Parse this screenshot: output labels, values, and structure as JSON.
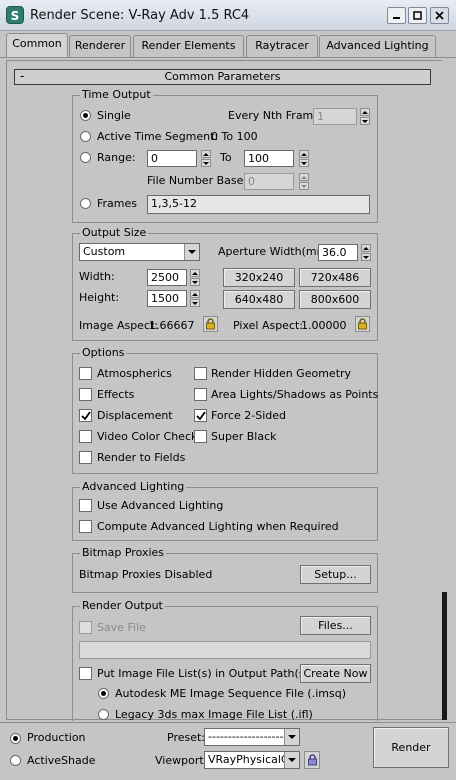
{
  "window": {
    "title": "Render Scene: V-Ray Adv 1.5 RC4",
    "app_icon_glyph": "S"
  },
  "tabs": [
    "Common",
    "Renderer",
    "Render Elements",
    "Raytracer",
    "Advanced Lighting"
  ],
  "active_tab": "Common",
  "rollout": {
    "title": "Common Parameters",
    "toggle": "-"
  },
  "time_output": {
    "title": "Time Output",
    "single_label": "Single",
    "single_selected": true,
    "every_nth_label": "Every Nth Frame:",
    "every_nth_value": "1",
    "active_segment_label": "Active Time Segment:",
    "active_segment_value": "0 To 100",
    "range_label": "Range:",
    "range_from": "0",
    "range_to_label": "To",
    "range_to": "100",
    "file_number_base_label": "File Number Base:",
    "file_number_base_value": "0",
    "frames_label": "Frames",
    "frames_value": "1,3,5-12"
  },
  "output_size": {
    "title": "Output Size",
    "preset_value": "Custom",
    "aperture_label": "Aperture Width(mm):",
    "aperture_value": "36.0",
    "width_label": "Width:",
    "width_value": "2500",
    "height_label": "Height:",
    "height_value": "1500",
    "presets": [
      "320x240",
      "720x486",
      "640x480",
      "800x600"
    ],
    "image_aspect_label": "Image Aspect:",
    "image_aspect_value": "1.66667",
    "pixel_aspect_label": "Pixel Aspect:",
    "pixel_aspect_value": "1.00000"
  },
  "options": {
    "title": "Options",
    "left": [
      {
        "label": "Atmospherics",
        "checked": false
      },
      {
        "label": "Effects",
        "checked": false
      },
      {
        "label": "Displacement",
        "checked": true
      },
      {
        "label": "Video Color Check",
        "checked": false
      },
      {
        "label": "Render to Fields",
        "checked": false
      }
    ],
    "right": [
      {
        "label": "Render Hidden Geometry",
        "checked": false
      },
      {
        "label": "Area Lights/Shadows as Points",
        "checked": false
      },
      {
        "label": "Force 2-Sided",
        "checked": true
      },
      {
        "label": "Super Black",
        "checked": false
      }
    ]
  },
  "advanced_lighting": {
    "title": "Advanced Lighting",
    "use_label": "Use Advanced Lighting",
    "use_checked": false,
    "compute_label": "Compute Advanced Lighting when Required",
    "compute_checked": false
  },
  "bitmap_proxies": {
    "title": "Bitmap Proxies",
    "status": "Bitmap Proxies Disabled",
    "setup_label": "Setup..."
  },
  "render_output": {
    "title": "Render Output",
    "save_file_label": "Save File",
    "files_label": "Files...",
    "path_value": "",
    "put_list_label": "Put Image File List(s) in Output Path(s)",
    "create_now_label": "Create Now",
    "autodesk_label": "Autodesk ME Image Sequence File (.imsq)",
    "autodesk_selected": true,
    "legacy_label": "Legacy 3ds max Image File List (.ifl)",
    "legacy_selected": false
  },
  "bottom": {
    "production_label": "Production",
    "production_selected": true,
    "activeshade_label": "ActiveShade",
    "activeshade_selected": false,
    "preset_label": "Preset:",
    "preset_value": "----------------------------",
    "viewport_label": "Viewport:",
    "viewport_value": "VRayPhysicalCa",
    "render_label": "Render"
  }
}
